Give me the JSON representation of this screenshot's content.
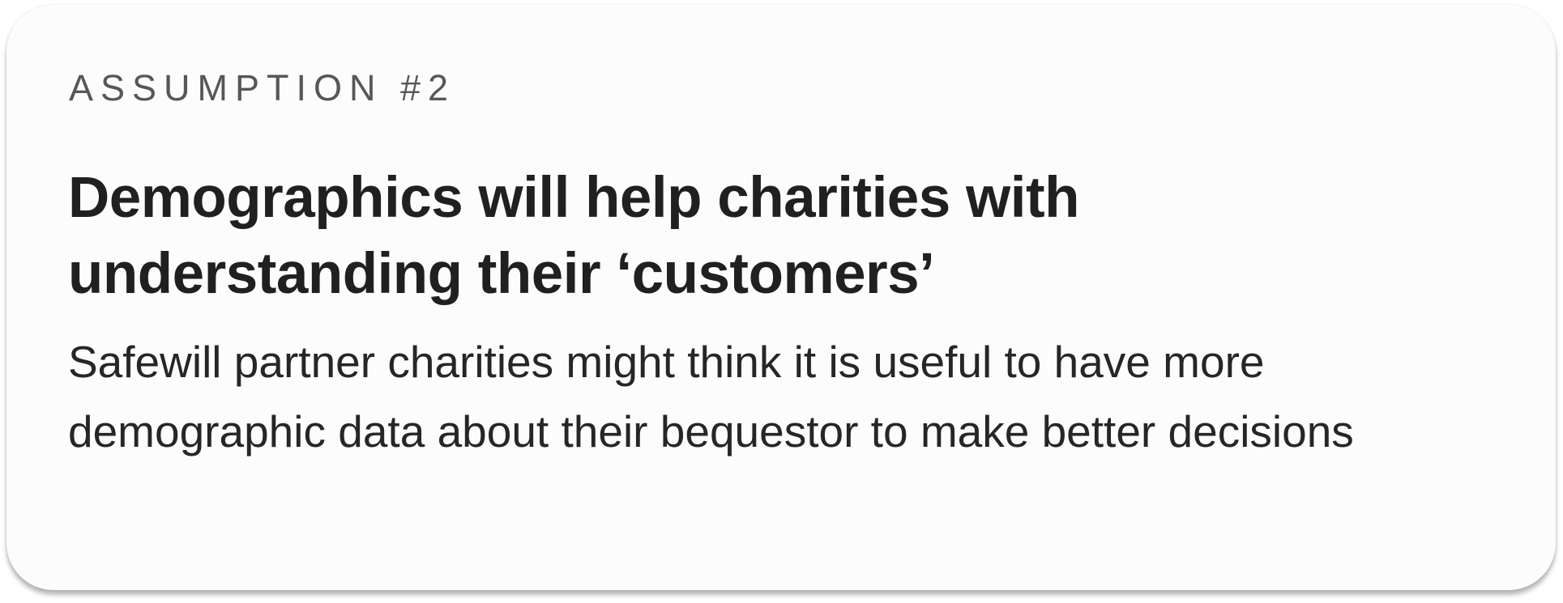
{
  "card": {
    "eyebrow": "ASSUMPTION #2",
    "title": "Demographics will help charities with understanding their ‘customers’",
    "body": "Safewill partner charities might think it is useful to have more demographic data about their bequestor to make better decisions"
  },
  "colors": {
    "card_background": "#fcfcfc",
    "eyebrow_text": "#575757",
    "title_text": "#202020",
    "body_text": "#262626"
  }
}
